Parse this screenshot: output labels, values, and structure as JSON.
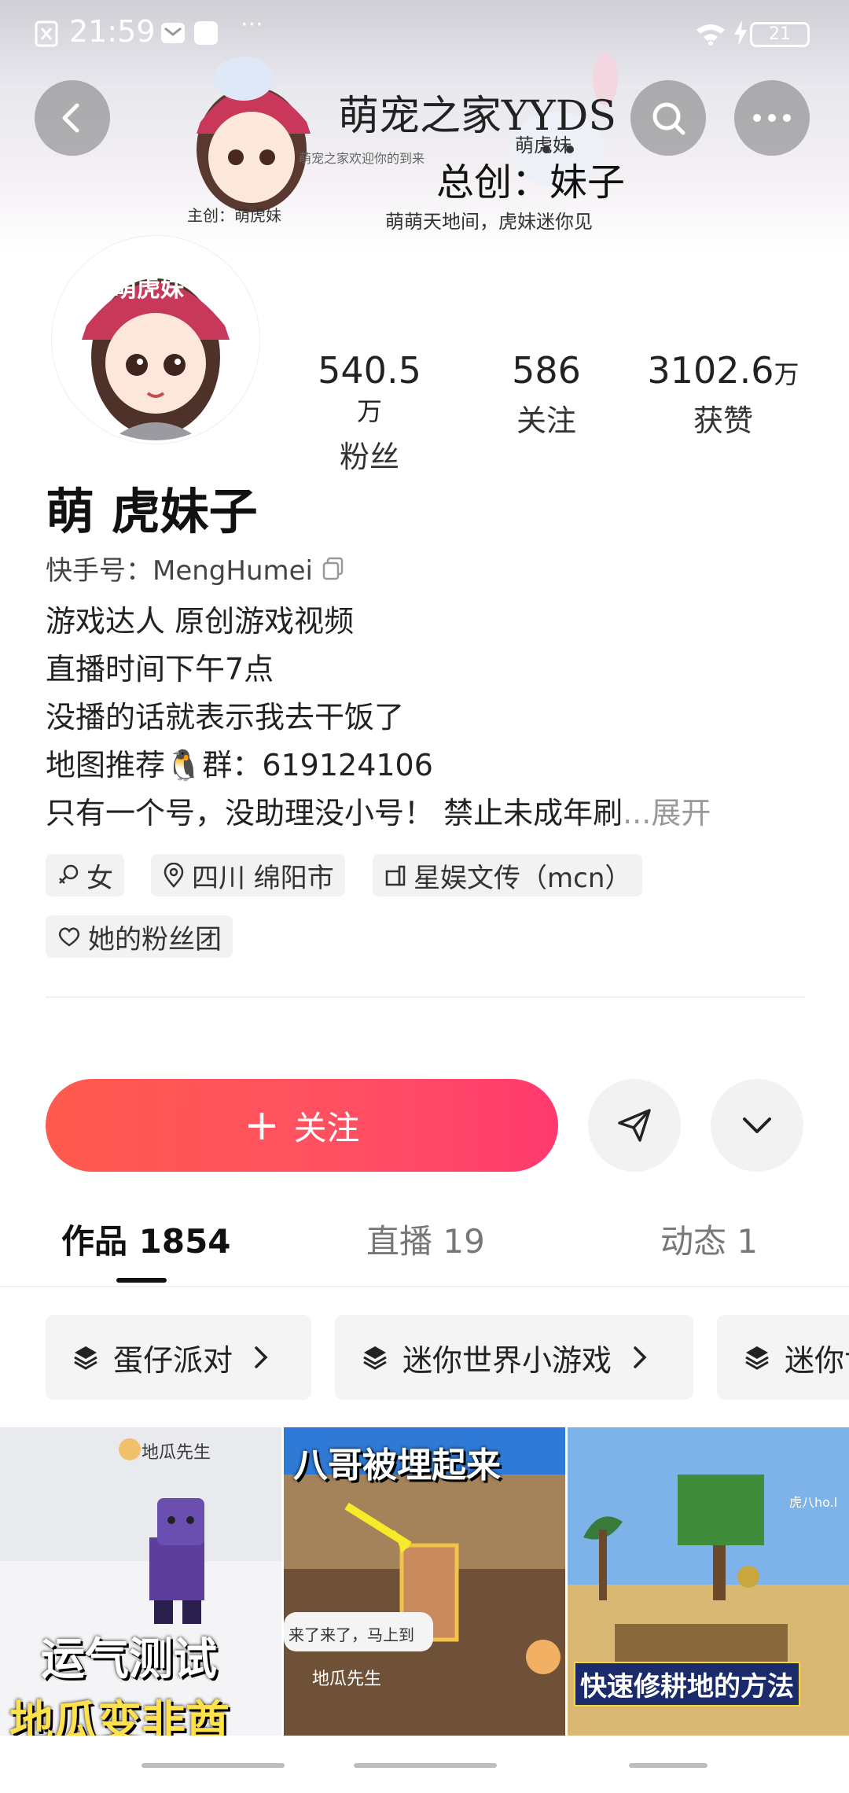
{
  "status_bar": {
    "time": "21:59",
    "battery": "21"
  },
  "banner": {
    "line1": "萌宠之家YYDS",
    "line2": "萌虎妹",
    "line3": "总创：妹子",
    "line4": "萌萌天地间，虎妹迷你见",
    "line5": "主创：萌虎妹",
    "line6": "萌宠之家欢迎你的到来",
    "cap_text": "萌虎妹"
  },
  "profile": {
    "name": "萌 虎妹子",
    "kuaishou_id": "快手号：MengHumei",
    "stats": [
      {
        "num": "540.5",
        "unit": "万",
        "label": "粉丝"
      },
      {
        "num": "586",
        "unit": "",
        "label": "关注"
      },
      {
        "num": "3102.6",
        "unit": "万",
        "label": "获赞"
      }
    ],
    "bio": [
      "游戏达人 原创游戏视频",
      "直播时间下午7点",
      "没播的话就表示我去干饭了",
      "地图推荐🐧群：619124106",
      "只有一个号，没助理没小号！ 禁止未成年刷"
    ],
    "bio_more": "...展开",
    "tags": [
      "女",
      "四川 绵阳市",
      "星娱文传（mcn）",
      "她的粉丝团"
    ]
  },
  "actions": {
    "follow_label": "关注"
  },
  "tabs": [
    {
      "label": "作品 1854"
    },
    {
      "label": "直播 19"
    },
    {
      "label": "动态 1"
    }
  ],
  "collections": [
    "蛋仔派对",
    "迷你世界小游戏",
    "迷你世"
  ],
  "videos": [
    {
      "watermark": "地瓜先生",
      "caption1": "运气测试",
      "caption2": "地瓜变非酋"
    },
    {
      "watermark": "地瓜先生",
      "caption_top": "八哥被埋起来",
      "bubble": "来了来了，马上到"
    },
    {
      "caption": "快速修耕地的方法",
      "watermark": "虎八ho.l"
    }
  ],
  "colors": {
    "follow_start": "#ff5a4e",
    "follow_end": "#ff3a6e"
  },
  "icons": [
    "back-icon",
    "search-icon",
    "more-icon",
    "copy-icon",
    "gender-icon",
    "location-icon",
    "building-icon",
    "heart-icon",
    "share-icon",
    "chevron-down-icon",
    "layers-icon",
    "chevron-right-icon"
  ]
}
